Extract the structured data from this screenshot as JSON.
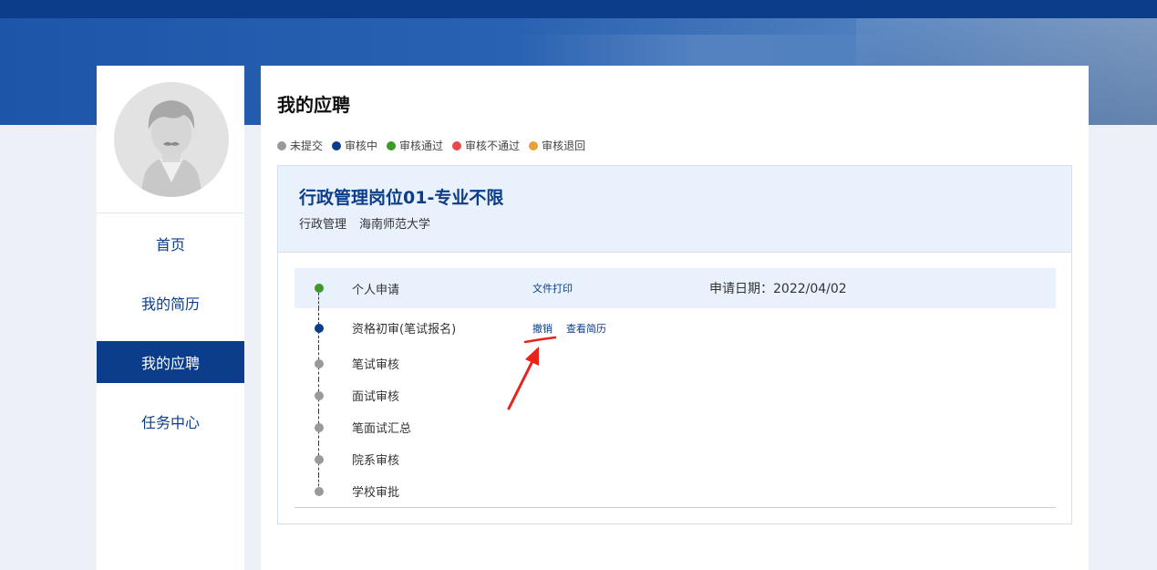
{
  "sidebar": {
    "nav": [
      {
        "label": "首页"
      },
      {
        "label": "我的简历"
      },
      {
        "label": "我的应聘",
        "active": true
      },
      {
        "label": "任务中心"
      }
    ]
  },
  "main": {
    "title": "我的应聘",
    "legend": [
      {
        "label": "未提交",
        "color": "#9a9a9a"
      },
      {
        "label": "审核中",
        "color": "#0b3d8a"
      },
      {
        "label": "审核通过",
        "color": "#3a9a2a"
      },
      {
        "label": "审核不通过",
        "color": "#e84a4a"
      },
      {
        "label": "审核退回",
        "color": "#e8a03a"
      }
    ],
    "job": {
      "title": "行政管理岗位01-专业不限",
      "department": "行政管理",
      "school": "海南师范大学"
    },
    "steps": [
      {
        "name": "个人申请",
        "status_color": "#3a9a2a",
        "action": "文件打印",
        "date_label": "申请日期：",
        "date": "2022/04/02"
      },
      {
        "name": "资格初审(笔试报名)",
        "status_color": "#0b3d8a",
        "action": "撤销",
        "action2": "查看简历"
      },
      {
        "name": "笔试审核",
        "status_color": "#9a9a9a"
      },
      {
        "name": "面试审核",
        "status_color": "#9a9a9a"
      },
      {
        "name": "笔面试汇总",
        "status_color": "#9a9a9a"
      },
      {
        "name": "院系审核",
        "status_color": "#9a9a9a"
      },
      {
        "name": "学校审批",
        "status_color": "#9a9a9a"
      }
    ]
  }
}
